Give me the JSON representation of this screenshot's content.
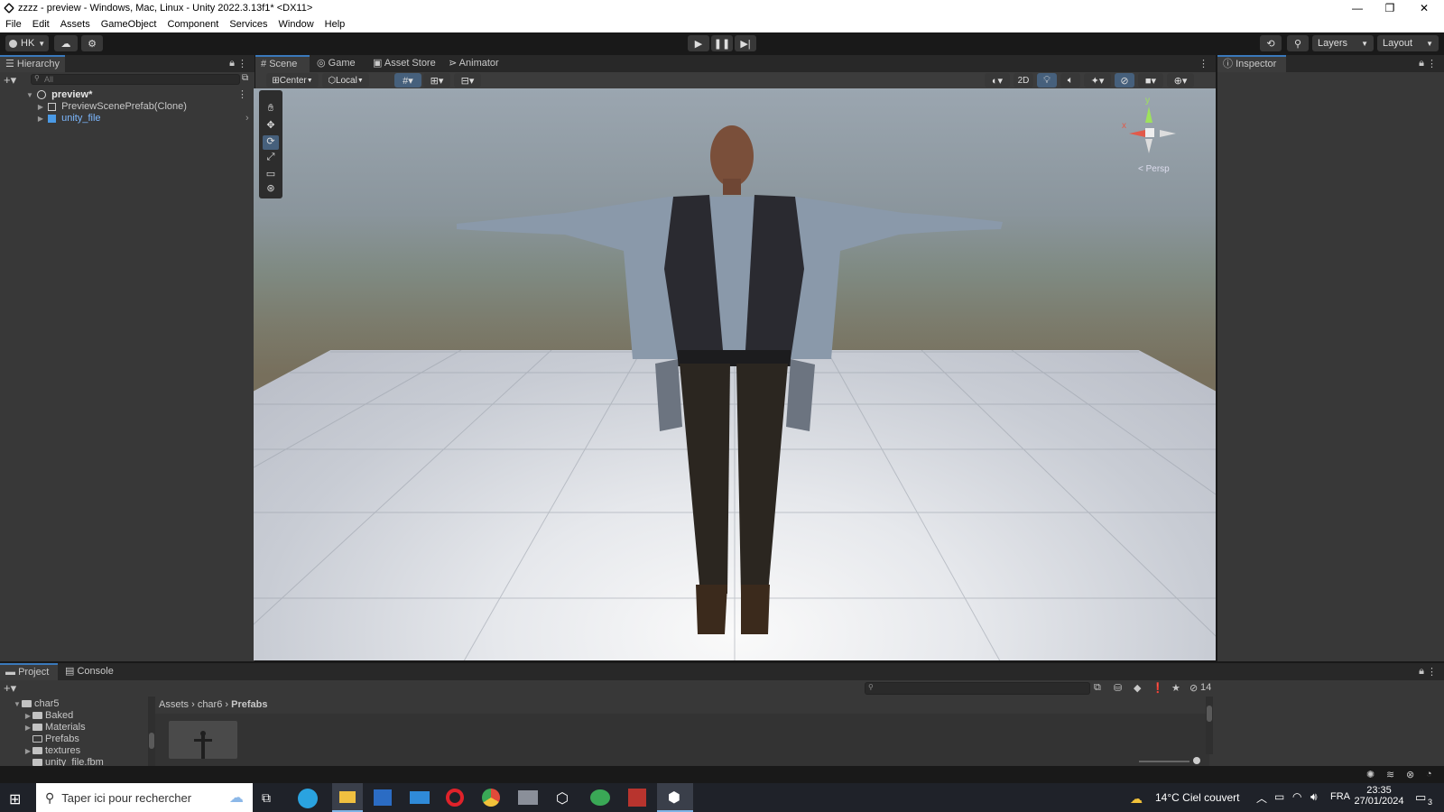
{
  "window": {
    "title": "zzzz - preview - Windows, Mac, Linux - Unity 2022.3.13f1* <DX11>",
    "minimize": "—",
    "maximize": "❐",
    "close": "✕"
  },
  "menu": [
    "File",
    "Edit",
    "Assets",
    "GameObject",
    "Component",
    "Services",
    "Window",
    "Help"
  ],
  "toolbar": {
    "account": "HK",
    "layers": "Layers",
    "layout": "Layout"
  },
  "hierarchy": {
    "tab": "Hierarchy",
    "search_placeholder": "All",
    "scene": "preview*",
    "items": [
      "PreviewScenePrefab(Clone)",
      "unity_file"
    ]
  },
  "scene_tabs": [
    "Scene",
    "Game",
    "Asset Store",
    "Animator"
  ],
  "scene_toolbar": {
    "pivot": "Center",
    "space": "Local",
    "mode_2d": "2D"
  },
  "gizmo": {
    "y": "y",
    "x": "x",
    "projection": "< Persp"
  },
  "inspector": {
    "tab": "Inspector"
  },
  "bottom_tabs": [
    "Project",
    "Console"
  ],
  "project": {
    "tree": [
      {
        "name": "char5",
        "level": 0,
        "expanded": true
      },
      {
        "name": "Baked",
        "level": 1,
        "expanded": false
      },
      {
        "name": "Materials",
        "level": 1,
        "expanded": false
      },
      {
        "name": "Prefabs",
        "level": 1,
        "expanded": null
      },
      {
        "name": "textures",
        "level": 1,
        "expanded": false
      },
      {
        "name": "unity_file.fbm",
        "level": 1,
        "expanded": null
      }
    ],
    "breadcrumb": [
      "Assets",
      "char6",
      "Prefabs"
    ],
    "hidden_count": "14"
  },
  "taskbar": {
    "search_placeholder": "Taper ici pour rechercher",
    "weather": "14°C  Ciel couvert",
    "lang": "FRA",
    "time": "23:35",
    "date": "27/01/2024",
    "notifications": "3"
  }
}
